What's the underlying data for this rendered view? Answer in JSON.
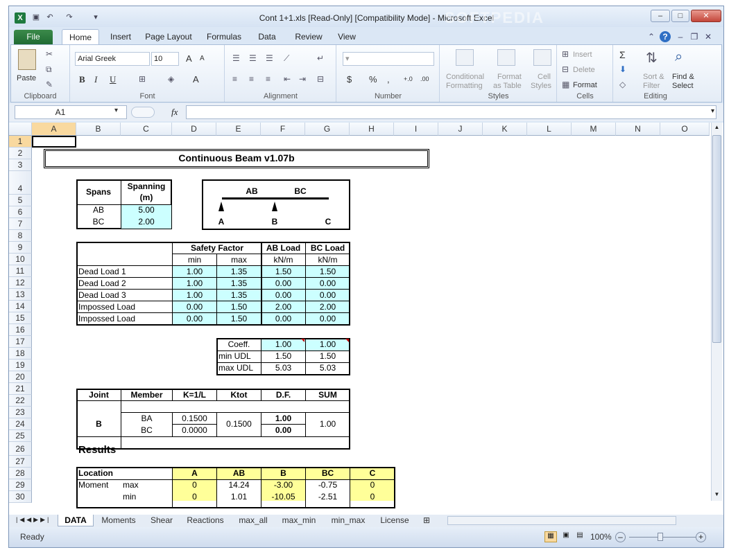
{
  "window": {
    "title": "Cont 1+1.xls  [Read-Only]  [Compatibility Mode]  -  Microsoft Excel",
    "controls": {
      "minimize": "–",
      "maximize": "□",
      "close": "✕"
    }
  },
  "ribbon_tabs": {
    "file": "File",
    "home": "Home",
    "insert": "Insert",
    "page_layout": "Page Layout",
    "formulas": "Formulas",
    "data": "Data",
    "review": "Review",
    "view": "View"
  },
  "ribbon": {
    "clipboard": {
      "paste": "Paste",
      "label": "Clipboard"
    },
    "font": {
      "name": "Arial Greek",
      "size": "10",
      "bold": "B",
      "italic": "I",
      "underline": "U",
      "grow": "A",
      "shrink": "A",
      "font_color": "A",
      "label": "Font"
    },
    "alignment": {
      "label": "Alignment"
    },
    "number": {
      "currency": "$",
      "percent": "%",
      "comma": ",",
      "inc_decimal": "+.0",
      "dec_decimal": ".00",
      "label": "Number"
    },
    "styles": {
      "conditional": "Conditional",
      "conditional2": "Formatting",
      "format_table": "Format",
      "format_table2": "as Table",
      "cell_styles": "Cell",
      "cell_styles2": "Styles",
      "label": "Styles"
    },
    "cells": {
      "insert": "Insert",
      "delete": "Delete",
      "format": "Format",
      "label": "Cells"
    },
    "editing": {
      "sum": "Σ",
      "sort": "Sort &",
      "sort2": "Filter",
      "find": "Find &",
      "find2": "Select",
      "label": "Editing"
    }
  },
  "formula_bar": {
    "namebox": "A1",
    "fx": "fx",
    "formula": ""
  },
  "columns": [
    "A",
    "B",
    "C",
    "D",
    "E",
    "F",
    "G",
    "H",
    "I",
    "J",
    "K",
    "L",
    "M",
    "N",
    "O"
  ],
  "rows": [
    "1",
    "2",
    "3",
    "4",
    "5",
    "6",
    "7",
    "8",
    "9",
    "10",
    "11",
    "12",
    "13",
    "14",
    "15",
    "16",
    "17",
    "18",
    "19",
    "20",
    "21",
    "22",
    "23",
    "24",
    "25",
    "26",
    "27",
    "28",
    "29",
    "30"
  ],
  "sheet": {
    "title": "Continuous Beam v1.07b",
    "spans": {
      "h1": "Spans",
      "h2a": "Spanning",
      "h2b": "(m)",
      "r1": "AB",
      "v1": "5.00",
      "r2": "BC",
      "v2": "2.00"
    },
    "diagram": {
      "ab": "AB",
      "bc": "BC",
      "a": "A",
      "b": "B",
      "c": "C"
    },
    "loads": {
      "safety_factor": "Safety Factor",
      "ab_load": "AB Load",
      "bc_load": "BC Load",
      "min": "min",
      "max": "max",
      "unit1": "kN/m",
      "unit2": "kN/m",
      "rows": [
        {
          "name": "Dead Load 1",
          "min": "1.00",
          "max": "1.35",
          "ab": "1.50",
          "bc": "1.50"
        },
        {
          "name": "Dead Load 2",
          "min": "1.00",
          "max": "1.35",
          "ab": "0.00",
          "bc": "0.00"
        },
        {
          "name": "Dead Load 3",
          "min": "1.00",
          "max": "1.35",
          "ab": "0.00",
          "bc": "0.00"
        },
        {
          "name": "Impossed Load",
          "min": "0.00",
          "max": "1.50",
          "ab": "2.00",
          "bc": "2.00"
        },
        {
          "name": "Impossed Load",
          "min": "0.00",
          "max": "1.50",
          "ab": "0.00",
          "bc": "0.00"
        }
      ]
    },
    "udl": {
      "coeff": "Coeff.",
      "coeff_ab": "1.00",
      "coeff_bc": "1.00",
      "min": "min UDL",
      "min_ab": "1.50",
      "min_bc": "1.50",
      "max": "max UDL",
      "max_ab": "5.03",
      "max_bc": "5.03"
    },
    "joint": {
      "h_joint": "Joint",
      "h_member": "Member",
      "h_k": "K=1/L",
      "h_ktot": "Ktot",
      "h_df": "D.F.",
      "h_sum": "SUM",
      "joint": "B",
      "m1": "BA",
      "m2": "BC",
      "k1": "0.1500",
      "k2": "0.0000",
      "ktot": "0.1500",
      "df1": "1.00",
      "df2": "0.00",
      "sum": "1.00"
    },
    "results_label": "Results",
    "results": {
      "location": "Location",
      "a": "A",
      "ab": "AB",
      "b": "B",
      "bc": "BC",
      "c": "C",
      "moment": "Moment",
      "max": "max",
      "row29": [
        "0",
        "14.24",
        "-3.00",
        "-0.75",
        "0"
      ],
      "min": "min",
      "row30": [
        "0",
        "1.01",
        "-10.05",
        "-2.51",
        "0"
      ]
    }
  },
  "sheet_tabs": [
    "DATA",
    "Moments",
    "Shear",
    "Reactions",
    "max_all",
    "max_min",
    "min_max",
    "License"
  ],
  "status": {
    "ready": "Ready",
    "zoom": "100%"
  },
  "watermark": "SOFTPEDIA"
}
